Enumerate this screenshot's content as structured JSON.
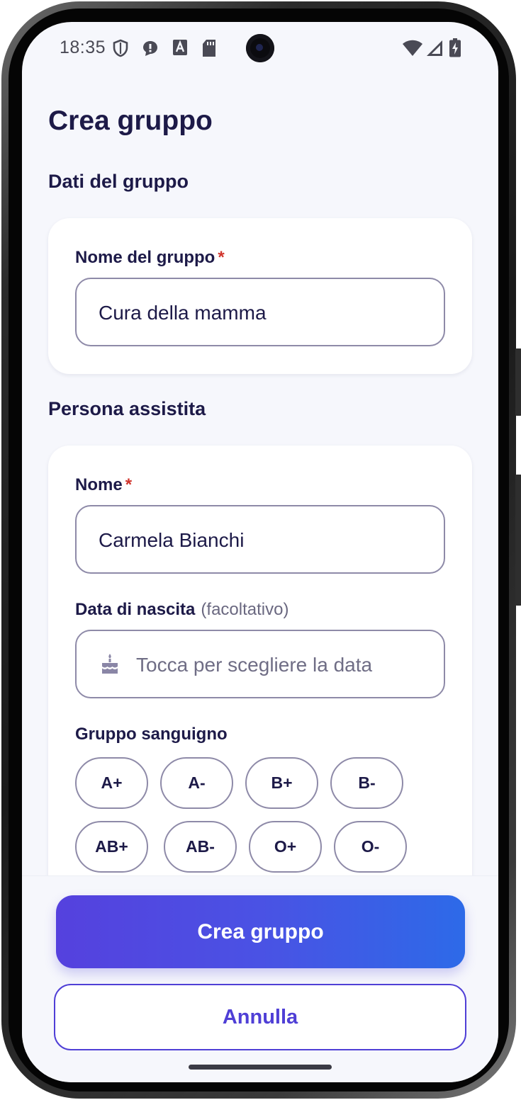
{
  "status_bar": {
    "time": "18:35",
    "icons": [
      "shield-icon",
      "chat-alert-icon",
      "font-a-icon",
      "sd-card-icon",
      "wifi-icon",
      "cellular-signal-icon",
      "battery-charging-icon"
    ]
  },
  "page": {
    "title": "Crea gruppo"
  },
  "group_section": {
    "title": "Dati del gruppo",
    "name_label": "Nome del gruppo",
    "required_mark": "*",
    "name_value": "Cura della mamma"
  },
  "person_section": {
    "title": "Persona assistita",
    "name_label": "Nome",
    "required_mark": "*",
    "name_value": "Carmela Bianchi",
    "birthdate_label": "Data di nascita",
    "birthdate_optional": "(facoltativo)",
    "birthdate_placeholder": "Tocca per scegliere la data",
    "birthdate_icon": "cake-icon",
    "blood_group_label": "Gruppo sanguigno",
    "blood_groups": [
      "A+",
      "A-",
      "B+",
      "B-",
      "AB+",
      "AB-",
      "O+",
      "O-"
    ]
  },
  "actions": {
    "create_label": "Crea gruppo",
    "cancel_label": "Annulla"
  },
  "colors": {
    "title": "#1d1a48",
    "required": "#d0342c",
    "primary_gradient_start": "#5541de",
    "primary_gradient_end": "#2d6ae8",
    "secondary_border": "#4f3fd6",
    "background": "#f6f7fc"
  }
}
